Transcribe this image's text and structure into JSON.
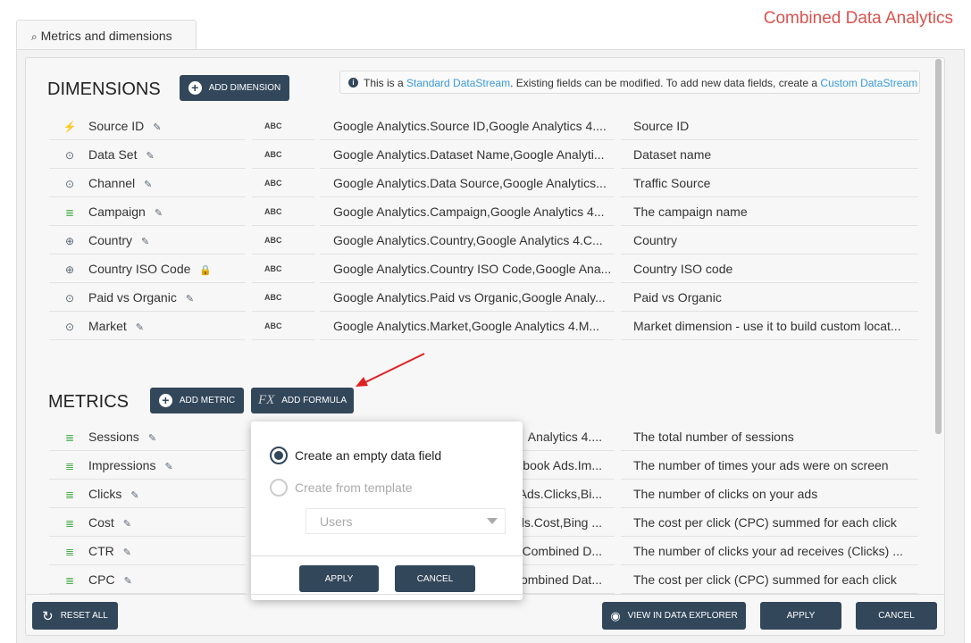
{
  "app_title": "Combined Data Analytics",
  "tab": {
    "label": "Metrics and dimensions",
    "icon": "search-icon"
  },
  "dimensions": {
    "title": "DIMENSIONS",
    "add_label": "ADD DIMENSION",
    "info": {
      "pre": "This is a ",
      "link1": "Standard DataStream",
      "mid": ". Existing fields can be modified. To add new data fields, create a ",
      "link2": "Custom DataStream"
    },
    "rows": [
      {
        "icon": "plug-icon",
        "name": "Source ID",
        "action": "pencil-icon",
        "type": "ABC",
        "source": "Google Analytics.Source ID,Google Analytics 4....",
        "desc": "Source ID"
      },
      {
        "icon": "target-icon",
        "name": "Data Set",
        "action": "pencil-icon",
        "type": "ABC",
        "source": "Google Analytics.Dataset Name,Google Analyti...",
        "desc": "Dataset name"
      },
      {
        "icon": "target-icon",
        "name": "Channel",
        "action": "pencil-icon",
        "type": "ABC",
        "source": "Google Analytics.Data Source,Google Analytics...",
        "desc": "Traffic Source"
      },
      {
        "icon": "database-icon",
        "name": "Campaign",
        "action": "pencil-icon",
        "type": "ABC",
        "source": "Google Analytics.Campaign,Google Analytics 4...",
        "desc": "The campaign name"
      },
      {
        "icon": "globe-icon",
        "name": "Country",
        "action": "pencil-icon",
        "type": "ABC",
        "source": "Google Analytics.Country,Google Analytics 4.C...",
        "desc": "Country"
      },
      {
        "icon": "globe-icon",
        "name": "Country ISO Code",
        "action": "lock-icon",
        "type": "ABC",
        "source": "Google Analytics.Country ISO Code,Google Ana...",
        "desc": "Country ISO code"
      },
      {
        "icon": "target-icon",
        "name": "Paid vs Organic",
        "action": "pencil-icon",
        "type": "ABC",
        "source": "Google Analytics.Paid vs Organic,Google Analy...",
        "desc": "Paid vs Organic"
      },
      {
        "icon": "target-icon",
        "name": "Market",
        "action": "pencil-icon",
        "type": "ABC",
        "source": "Google Analytics.Market,Google Analytics 4.M...",
        "desc": "Market dimension - use it to build custom locat..."
      }
    ]
  },
  "metrics": {
    "title": "METRICS",
    "add_label": "ADD METRIC",
    "formula_label": "ADD FORMULA",
    "formula_icon": "fx",
    "rows": [
      {
        "name": "Sessions",
        "source": "Analytics 4....",
        "desc": "The total number of sessions"
      },
      {
        "name": "Impressions",
        "source": "book Ads.Im...",
        "desc": "The number of times your ads were on screen"
      },
      {
        "name": "Clicks",
        "source": "Ads.Clicks,Bi...",
        "desc": "The number of clicks on your ads"
      },
      {
        "name": "Cost",
        "source": "ds.Cost,Bing ...",
        "desc": "The cost per click (CPC) summed for each click"
      },
      {
        "name": "CTR",
        "source": "Combined D...",
        "desc": "The number of clicks your ad receives (Clicks) ..."
      },
      {
        "name": "CPC",
        "source": "ombined Dat...",
        "desc": "The cost per click (CPC) summed for each click"
      }
    ]
  },
  "popup": {
    "option1": "Create an empty data field",
    "option2": "Create from template",
    "template_value": "Users",
    "apply": "APPLY",
    "cancel": "CANCEL",
    "selected": "option1"
  },
  "footer": {
    "reset": "RESET ALL",
    "view": "VIEW IN DATA EXPLORER",
    "apply": "APPLY",
    "cancel": "CANCEL"
  },
  "colors": {
    "accent": "#33475b",
    "title": "#d9534f",
    "link": "#3a9ad9",
    "arrow": "#e02020"
  }
}
